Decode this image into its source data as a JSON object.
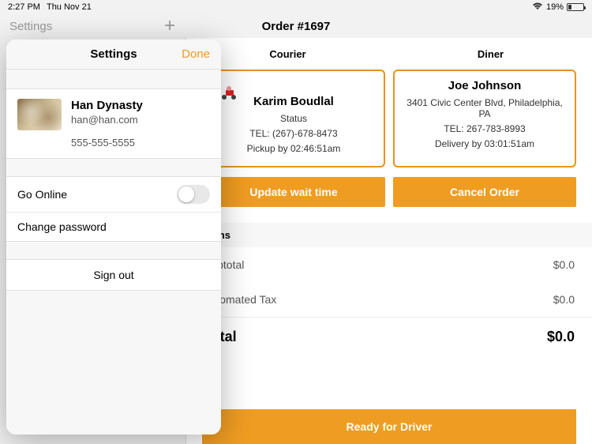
{
  "status": {
    "time": "2:27 PM",
    "date": "Thu Nov 21",
    "battery_pct": "19%"
  },
  "nav": {
    "settings_label": "Settings",
    "order_title": "Order #1697"
  },
  "tabs": {
    "courier": "Courier",
    "diner": "Diner"
  },
  "courier": {
    "name": "Karim Boudlal",
    "status": "Status",
    "tel": "TEL: (267)-678-8473",
    "pickup": "Pickup by 02:46:51am"
  },
  "diner": {
    "name": "Joe Johnson",
    "address": "3401 Civic Center Blvd, Philadelphia, PA",
    "tel": "TEL: 267-783-8993",
    "delivery": "Delivery by 03:01:51am"
  },
  "actions": {
    "update_wait": "Update wait time",
    "cancel": "Cancel Order",
    "ready": "Ready for Driver"
  },
  "summary": {
    "items_label": "Items",
    "subtotal_label": "Subtotal",
    "subtotal_value": "$0.0",
    "tax_label": "Estomated Tax",
    "tax_value": "$0.0",
    "total_label": "Total",
    "total_value": "$0.0"
  },
  "popover": {
    "title": "Settings",
    "done": "Done",
    "profile": {
      "name": "Han Dynasty",
      "email": "han@han.com",
      "phone": "555-555-5555"
    },
    "go_online": "Go Online",
    "change_pw": "Change password",
    "sign_out": "Sign out"
  }
}
